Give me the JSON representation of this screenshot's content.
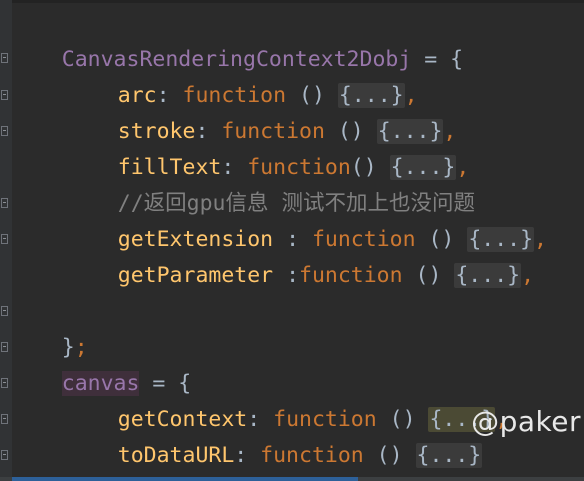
{
  "code": {
    "line1": {
      "name": "CanvasRenderingContext2Dobj",
      "rest": " = {"
    },
    "line2": {
      "prop": "arc",
      "colon": ": ",
      "kw": "function",
      "parens": " () ",
      "body": "{...}",
      "comma": ","
    },
    "line3": {
      "prop": "stroke",
      "colon": ": ",
      "kw": "function",
      "parens": " () ",
      "body": "{...}",
      "comma": ","
    },
    "line4": {
      "prop": "fillText",
      "colon": ": ",
      "kw": "function",
      "parens": "() ",
      "body": "{...}",
      "comma": ","
    },
    "line5": {
      "comment": "//返回gpu信息 测试不加上也没问题"
    },
    "line6": {
      "prop": "getExtension",
      "colon": " : ",
      "kw": "function",
      "parens": " () ",
      "body": "{...}",
      "comma": ","
    },
    "line7": {
      "prop": "getParameter",
      "colon": " :",
      "kw": "function",
      "parens": " () ",
      "body": "{...}",
      "comma": ","
    },
    "line9": {
      "brace": "}",
      "semi": ";"
    },
    "line10": {
      "name": "canvas",
      "rest": " = {"
    },
    "line11": {
      "prop": "getContext",
      "colon": ": ",
      "kw": "function",
      "parens": " () ",
      "body": "{...}",
      "comma": ","
    },
    "line12": {
      "prop": "toDataURL",
      "colon": ": ",
      "kw": "function",
      "parens": " () ",
      "body": "{...}"
    },
    "line13": {
      "brace": "}",
      "semi": ";"
    }
  },
  "watermark": "@paker",
  "colors": {
    "background": "#2b2b2b",
    "keyword": "#cc7832",
    "property": "#ffc66d",
    "global_var": "#9876aa",
    "comment": "#808080",
    "plain": "#a9b7c6"
  },
  "icons": {
    "fold_marker": "fold-marker-icon"
  }
}
